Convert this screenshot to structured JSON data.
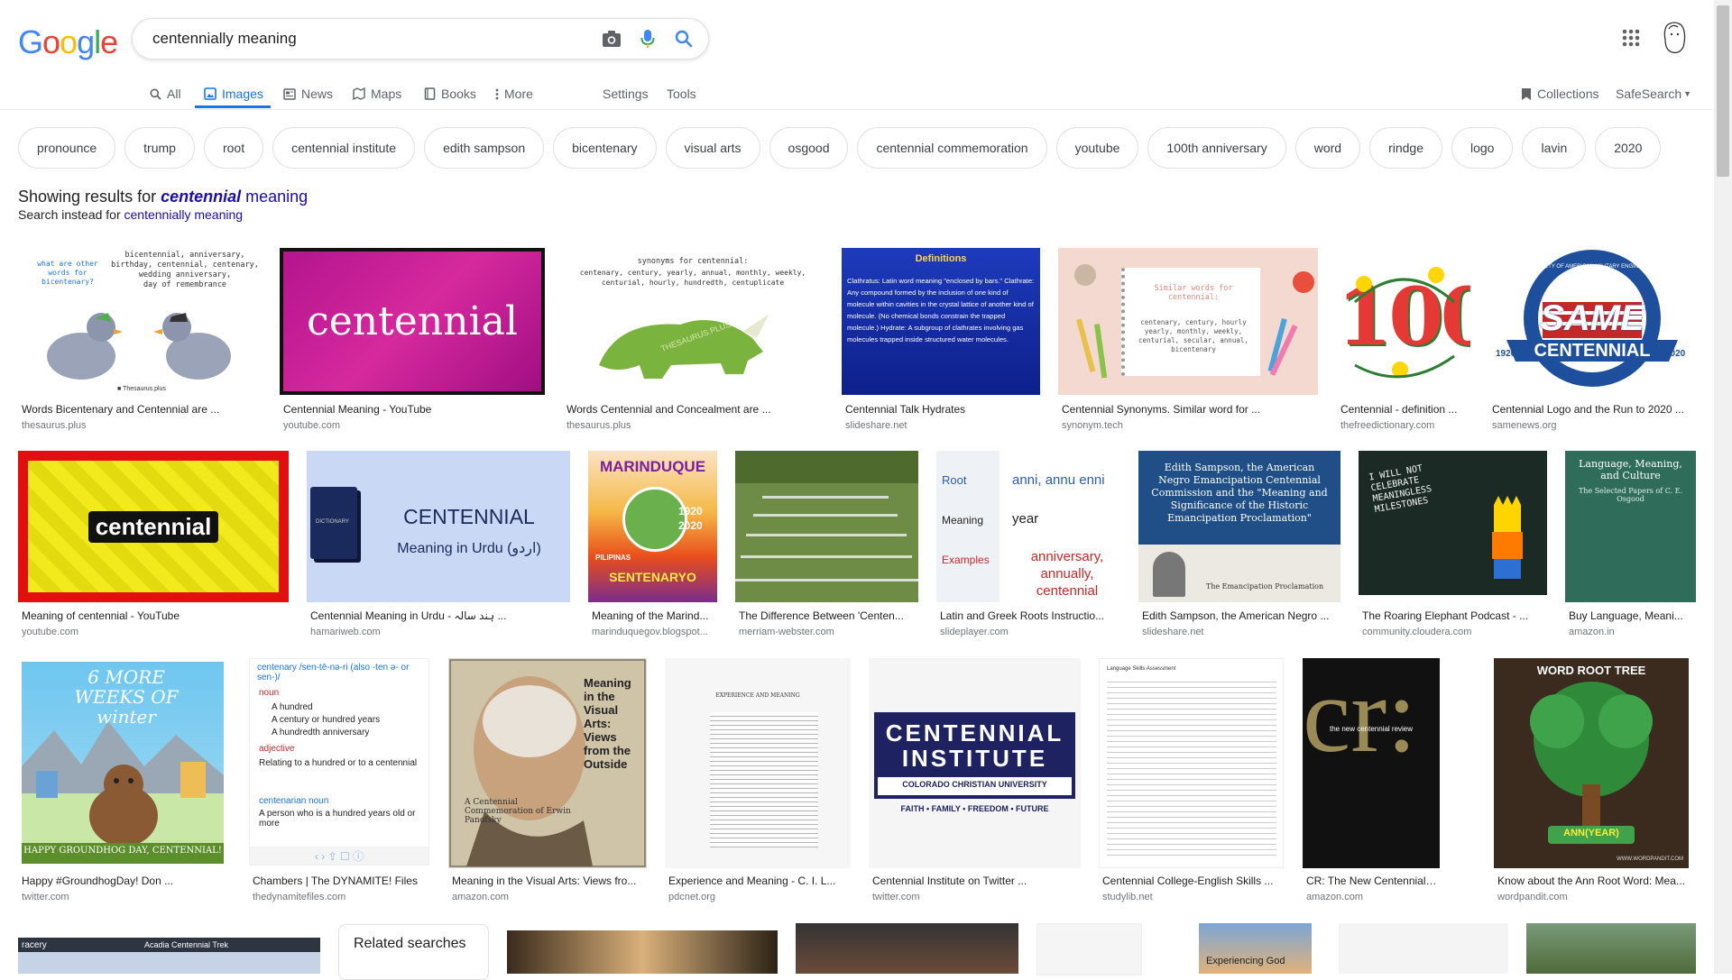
{
  "logo": {
    "g1": "G",
    "o1": "o",
    "o2": "o",
    "g2": "g",
    "l": "l",
    "e": "e"
  },
  "search": {
    "value": "centennially meaning",
    "placeholder": ""
  },
  "tabs": [
    {
      "label": "All"
    },
    {
      "label": "Images"
    },
    {
      "label": "News"
    },
    {
      "label": "Maps"
    },
    {
      "label": "Books"
    },
    {
      "label": "More"
    },
    {
      "label": "Settings"
    },
    {
      "label": "Tools"
    },
    {
      "label": "Collections"
    },
    {
      "label": "SafeSearch"
    }
  ],
  "chips": [
    "pronounce",
    "trump",
    "root",
    "centennial institute",
    "edith sampson",
    "bicentenary",
    "visual arts",
    "osgood",
    "centennial commemoration",
    "youtube",
    "100th anniversary",
    "word",
    "rindge",
    "logo",
    "lavin",
    "2020"
  ],
  "spelling": {
    "showing": "Showing results for",
    "corrected_bold": "centennial",
    "corrected_rest": "meaning",
    "instead": "Search instead for",
    "original": "centennially meaning"
  },
  "results": [
    {
      "title": "Words Bicentenary and Centennial are ...",
      "source": "thesaurus.plus",
      "thumb_text": "bicentennial, anniversary, birthday, centennial, centenary, wedding anniversary, day of remembrance",
      "thumb_text2": "what are other words for bicentenary?",
      "thumb_text3": "Thesaurus.plus"
    },
    {
      "title": "Centennial Meaning - YouTube",
      "source": "youtube.com",
      "thumb_text": "centennial"
    },
    {
      "title": "Words Centennial and Concealment are ...",
      "source": "thesaurus.plus",
      "thumb_text": "synonyms for centennial:",
      "thumb_text2": "centenary, century, yearly, annual, monthly, weekly, centurial, hourly, hundredth, centuplicate",
      "thumb_text3": "THESAURUS.PLUS"
    },
    {
      "title": "Centennial Talk Hydrates",
      "source": "slideshare.net",
      "thumb_text": "Definitions",
      "thumb_text2": "Clathratus: Latin word meaning \"enclosed by bars.\" Clathrate: Any compound formed by the inclusion of one kind of molecule within cavities in the crystal lattice of another kind of molecule. (No chemical bonds constrain the trapped molecule.) Hydrate: A subgroup of clathrates involving gas molecules trapped inside structured water molecules."
    },
    {
      "title": "Centennial Synonyms. Similar word for ...",
      "source": "synonym.tech",
      "thumb_text": "Similar words for centennial:",
      "thumb_text2": "centenary, century, hourly yearly, monthly, weekly, centurial, secular, annual, bicentenary"
    },
    {
      "title": "Centennial - definition ...",
      "source": "thefreedictionary.com",
      "thumb_text": "100"
    },
    {
      "title": "Centennial Logo and the Run to 2020 ...",
      "source": "samenews.org",
      "thumb_text": "SAME",
      "thumb_text2": "CENTENNIAL",
      "thumb_text3": "SOCIETY OF AMERICAN MILITARY ENGINEERS",
      "y1": "1920",
      "y2": "2020"
    },
    {
      "title": "Meaning of centennial - YouTube",
      "source": "youtube.com",
      "thumb_text": "centennial"
    },
    {
      "title": "Centennial Meaning in Urdu - ہند سالہ ...",
      "source": "hamariweb.com",
      "thumb_text": "CENTENNIAL",
      "thumb_text2": "Meaning in Urdu (اردو)",
      "thumb_text3": "DICTIONARY"
    },
    {
      "title": "Meaning of the Marind...",
      "source": "marinduquegov.blogspot...",
      "thumb_text": "MARINDUQUE",
      "thumb_text2": "SENTENARYO",
      "thumb_text3": "PILIPINAS",
      "y1": "1920",
      "y2": "2020"
    },
    {
      "title": "The Difference Between 'Centen...",
      "source": "merriam-webster.com"
    },
    {
      "title": "Latin and Greek Roots Instructio...",
      "source": "slideplayer.com",
      "thumb_text": "Root",
      "thumb_text2": "Meaning",
      "thumb_text3": "Examples",
      "v1": "anni, annu enni",
      "v2": "year",
      "v3": "anniversary, annually, centennial"
    },
    {
      "title": "Edith Sampson, the American Negro ...",
      "source": "slideshare.net",
      "thumb_text": "Edith Sampson, the American Negro Emancipation Centennial Commission and the \"Meaning and Significance of the Historic Emancipation Proclamation\"",
      "thumb_text2": "The Emancipation Proclamation"
    },
    {
      "title": "The Roaring Elephant Podcast - ...",
      "source": "community.cloudera.com",
      "thumb_text": "I WILL NOT CELEBRATE MEANINGLESS MILESTONES"
    },
    {
      "title": "Buy Language, Meani...",
      "source": "amazon.in",
      "thumb_text": "Language, Meaning, and Culture",
      "thumb_text2": "The Selected Papers of C. E. Osgood"
    },
    {
      "title": "Happy #GroundhogDay! Don ...",
      "source": "twitter.com",
      "thumb_text": "6 MORE WEEKS OF winter",
      "thumb_text2": "HAPPY GROUNDHOG DAY, CENTENNIAL!"
    },
    {
      "title": "Chambers | The DYNAMITE! Files",
      "source": "thedynamitefiles.com",
      "thumb_text": "centenary /sen-tē-nə-ri (also -ten ə- or sen-)/",
      "thumb_text2": "noun",
      "thumb_text3": "A hundred",
      "l4": "A century or hundred years",
      "l5": "A hundredth anniversary",
      "l6": "adjective",
      "l7": "Relating to a hundred or to a centennial",
      "l8": "centenarian noun",
      "l9": "A person who is a hundred years old or more"
    },
    {
      "title": "Meaning in the Visual Arts: Views fro...",
      "source": "amazon.com",
      "thumb_text": "Meaning in the Visual Arts: Views from the Outside",
      "thumb_text2": "A Centennial Commemoration of Erwin Panofsky"
    },
    {
      "title": "Experience and Meaning - C. I. L...",
      "source": "pdcnet.org",
      "thumb_text": "EXPERIENCE AND MEANING"
    },
    {
      "title": "Centennial Institute on Twitter ...",
      "source": "twitter.com",
      "thumb_text": "CENTENNIAL",
      "thumb_text2": "INSTITUTE",
      "thumb_text3": "COLORADO CHRISTIAN UNIVERSITY",
      "l4": "FAITH • FAMILY • FREEDOM • FUTURE"
    },
    {
      "title": "Centennial College-English Skills ...",
      "source": "studylib.net",
      "thumb_text": "Language Skills Assessment"
    },
    {
      "title": "CR: The New Centennial Revi...",
      "source": "amazon.com",
      "thumb_text": "cr:",
      "thumb_text2": "the new centennial review"
    },
    {
      "title": "Know about the Ann Root Word: Mea...",
      "source": "wordpandit.com",
      "thumb_text": "WORD ROOT TREE",
      "thumb_text2": "ANN(YEAR)",
      "thumb_text3": "WWW.WORDPANDIT.COM"
    }
  ],
  "related": {
    "label": "Related searches"
  },
  "bottom_row": {
    "t1": "racery",
    "t2": "Acadia Centennial Trek",
    "t3": "Experiencing God"
  },
  "colors": {
    "accent": "#1a73e8",
    "link": "#1a0dab",
    "source": "#70757a"
  }
}
